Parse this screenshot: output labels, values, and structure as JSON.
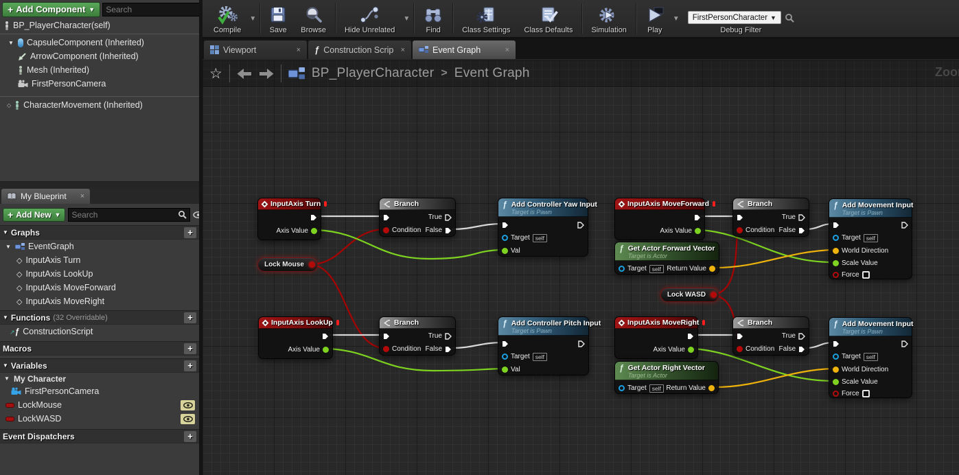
{
  "components_panel": {
    "add_component_label": "Add Component",
    "search_placeholder": "Search",
    "root_label": "BP_PlayerCharacter(self)",
    "tree": [
      {
        "label": "CapsuleComponent (Inherited)"
      },
      {
        "label": "ArrowComponent (Inherited)"
      },
      {
        "label": "Mesh (Inherited)"
      },
      {
        "label": "FirstPersonCamera"
      },
      {
        "label": "CharacterMovement (Inherited)"
      }
    ]
  },
  "toolbar": {
    "compile": "Compile",
    "save": "Save",
    "browse": "Browse",
    "hide_unrelated": "Hide Unrelated",
    "find": "Find",
    "class_settings": "Class Settings",
    "class_defaults": "Class Defaults",
    "simulation": "Simulation",
    "play": "Play",
    "debug_filter_value": "FirstPersonCharacter",
    "debug_filter_label": "Debug Filter"
  },
  "tabs": {
    "viewport": "Viewport",
    "construction": "Construction Scrip",
    "event_graph": "Event Graph"
  },
  "breadcrumb": {
    "root": "BP_PlayerCharacter",
    "separator": ">",
    "current": "Event Graph",
    "zoom_label": "Zoom"
  },
  "my_blueprint": {
    "tab_label": "My Blueprint",
    "add_new_label": "Add New",
    "search_placeholder": "Search",
    "graphs_header": "Graphs",
    "eventgraph_label": "EventGraph",
    "graph_items": [
      "InputAxis Turn",
      "InputAxis LookUp",
      "InputAxis MoveForward",
      "InputAxis MoveRight"
    ],
    "functions_header": "Functions",
    "functions_note": "(32 Overridable)",
    "construction_script": "ConstructionScript",
    "macros_header": "Macros",
    "variables_header": "Variables",
    "category_label": "My Character",
    "variables": [
      "FirstPersonCamera",
      "LockMouse",
      "LockWASD"
    ],
    "dispatchers_header": "Event Dispatchers"
  },
  "graph": {
    "nodes": {
      "turn": {
        "title": "InputAxis Turn"
      },
      "lookup": {
        "title": "InputAxis LookUp"
      },
      "moveforward": {
        "title": "InputAxis MoveForward"
      },
      "moveright": {
        "title": "InputAxis MoveRight"
      },
      "branch": {
        "title": "Branch"
      },
      "yaw": {
        "title": "Add Controller Yaw Input",
        "subtitle": "Target is Pawn"
      },
      "pitch": {
        "title": "Add Controller Pitch Input",
        "subtitle": "Target is Pawn"
      },
      "movement": {
        "title": "Add Movement Input",
        "subtitle": "Target is Pawn"
      },
      "forward_vector": {
        "title": "Get Actor Forward Vector",
        "subtitle": "Target is Actor"
      },
      "right_vector": {
        "title": "Get Actor Right Vector",
        "subtitle": "Target is Actor"
      },
      "lock_mouse": {
        "label": "Lock Mouse"
      },
      "lock_wasd": {
        "label": "Lock WASD"
      }
    },
    "pin_labels": {
      "axis_value": "Axis Value",
      "condition": "Condition",
      "true": "True",
      "false": "False",
      "target": "Target",
      "self": "self",
      "val": "Val",
      "world_direction": "World Direction",
      "scale_value": "Scale Value",
      "force": "Force",
      "return_value": "Return Value"
    }
  },
  "colors": {
    "accent_green": "#4f9e4f",
    "event_header": "#8e1111",
    "function_header": "#35617e",
    "pure_header": "#3e6b39",
    "exec_wire": "#e6e6e6",
    "bool_pin": "#b50a0a",
    "float_pin": "#7ed321",
    "vector_pin": "#eeb20c",
    "object_pin": "#1ba1e2"
  }
}
